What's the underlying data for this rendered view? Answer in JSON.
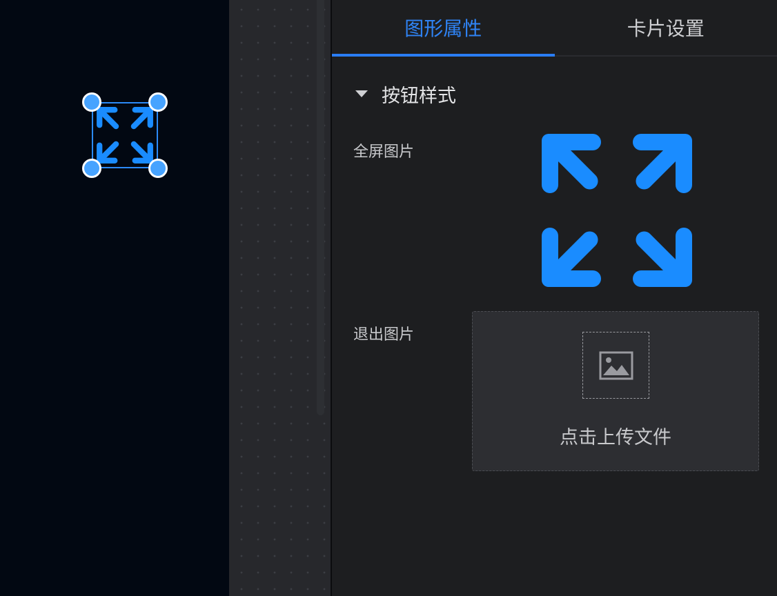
{
  "tabs": [
    {
      "label": "图形属性",
      "active": true
    },
    {
      "label": "卡片设置",
      "active": false
    }
  ],
  "section": {
    "title": "按钮样式",
    "expanded": true
  },
  "fields": {
    "fullscreen_label": "全屏图片",
    "exit_label": "退出图片"
  },
  "upload": {
    "text": "点击上传文件",
    "icon": "image-placeholder-icon"
  },
  "colors": {
    "accent": "#2f84f6",
    "icon_blue": "#1a8cff",
    "handle": "#47a3ff",
    "canvas_bg": "#020812",
    "panel_bg": "#1d1e20"
  },
  "icons": {
    "widget": "fullscreen-arrows-icon",
    "preview": "fullscreen-arrows-icon",
    "caret": "caret-down-icon"
  }
}
